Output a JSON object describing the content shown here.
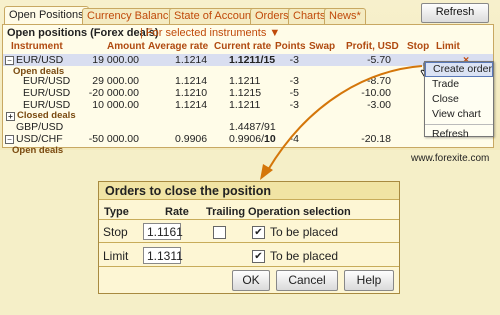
{
  "tabs": [
    {
      "label": "Open Positions",
      "active": true
    },
    {
      "label": "Currency Balances",
      "active": false
    },
    {
      "label": "State of Account",
      "active": false
    },
    {
      "label": "Orders",
      "active": false
    },
    {
      "label": "Charts",
      "active": false
    },
    {
      "label": "News*",
      "active": false
    }
  ],
  "toolbar": {
    "refresh_label": "Refresh"
  },
  "panel": {
    "title": "Open positions (Forex deals)",
    "filter": "| For selected instruments ▼"
  },
  "columns": {
    "instrument": "Instrument",
    "amount": "Amount",
    "avg_rate": "Average rate",
    "current_rate": "Current rate",
    "points": "Points",
    "swap": "Swap",
    "profit": "Profit, USD",
    "stop": "Stop",
    "limit": "Limit"
  },
  "rows": {
    "eurusd": {
      "instrument": "EUR/USD",
      "amount": "19 000.00",
      "avg_rate": "1.1214",
      "current_rate": "1.1211/15",
      "points": "-3",
      "profit": "-5.70",
      "close": "×"
    },
    "eurusd_open_deals": "Open deals",
    "deals": [
      {
        "instrument": "EUR/USD",
        "amount": "29 000.00",
        "avg_rate": "1.1214",
        "current_rate": "1.1211",
        "points": "-3",
        "profit": "-8.70"
      },
      {
        "instrument": "EUR/USD",
        "amount": "-20 000.00",
        "avg_rate": "1.1210",
        "current_rate": "1.1215",
        "points": "-5",
        "profit": "-10.00"
      },
      {
        "instrument": "EUR/USD",
        "amount": "10 000.00",
        "avg_rate": "1.1214",
        "current_rate": "1.1211",
        "points": "-3",
        "profit": "-3.00"
      }
    ],
    "closed_deals": "Closed deals",
    "gbpusd": {
      "instrument": "GBP/USD",
      "current_rate": "1.4487/91"
    },
    "usdchf": {
      "instrument": "USD/CHF",
      "amount": "-50 000.00",
      "avg_rate": "0.9906",
      "current_rate_main": "0.9906/",
      "current_rate_bold": "10",
      "points": "-4",
      "profit": "-20.18"
    },
    "usdchf_open_deals": "Open deals"
  },
  "context_menu": {
    "items": [
      "Create order",
      "Trade",
      "Close",
      "View chart",
      "Refresh"
    ]
  },
  "brand": "www.forexite.com",
  "dialog": {
    "title": "Orders to close the position",
    "headers": {
      "type": "Type",
      "rate": "Rate",
      "trailing": "Trailing",
      "operation": "Operation selection"
    },
    "stop": {
      "label": "Stop",
      "rate": "1.1161",
      "trailing": false,
      "placed": true,
      "placed_label": "To be placed"
    },
    "limit": {
      "label": "Limit",
      "rate": "1.1311",
      "placed": true,
      "placed_label": "To be placed"
    },
    "buttons": {
      "ok": "OK",
      "cancel": "Cancel",
      "help": "Help"
    }
  },
  "colors": {
    "accent": "#c04a0a",
    "background": "#f5efc8",
    "arrow": "#d4760a"
  }
}
